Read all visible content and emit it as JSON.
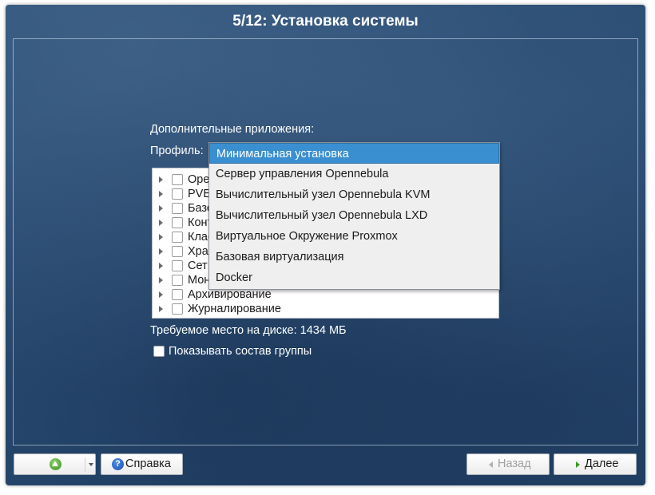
{
  "window": {
    "title": "5/12: Установка системы"
  },
  "main": {
    "additional_apps_label": "Дополнительные приложения:",
    "profile_label": "Профиль:",
    "disk_space": "Требуемое место на диске: 1434 МБ",
    "show_group_label": "Показывать состав группы"
  },
  "tree": {
    "items": [
      {
        "label": "Ope"
      },
      {
        "label": "PVE"
      },
      {
        "label": "Базо"
      },
      {
        "label": "Конт"
      },
      {
        "label": "Клас"
      },
      {
        "label": "Хран"
      },
      {
        "label": "Сет"
      },
      {
        "label": "Мон"
      },
      {
        "label": "Архивирование"
      },
      {
        "label": "Журналирование"
      }
    ]
  },
  "profile_dropdown": {
    "selected": "Минимальная установка",
    "options": [
      "Минимальная установка",
      "Сервер управления Opennebula",
      "Вычислительный узел Opennebula KVM",
      "Вычислительный узел Opennebula LXD",
      "Виртуальное Окружение Proxmox",
      "Базовая виртуализация",
      "Docker"
    ]
  },
  "footer": {
    "help_label": "Справка",
    "back_label": "Назад",
    "next_label": "Далее"
  },
  "icons": {
    "up": "up-arrow-icon",
    "help": "help-icon",
    "back": "chevron-left-icon",
    "next": "chevron-right-icon"
  },
  "colors": {
    "background": "#2a4c73",
    "selection": "#3a8fd0",
    "next_accent": "#3a9a1a"
  }
}
